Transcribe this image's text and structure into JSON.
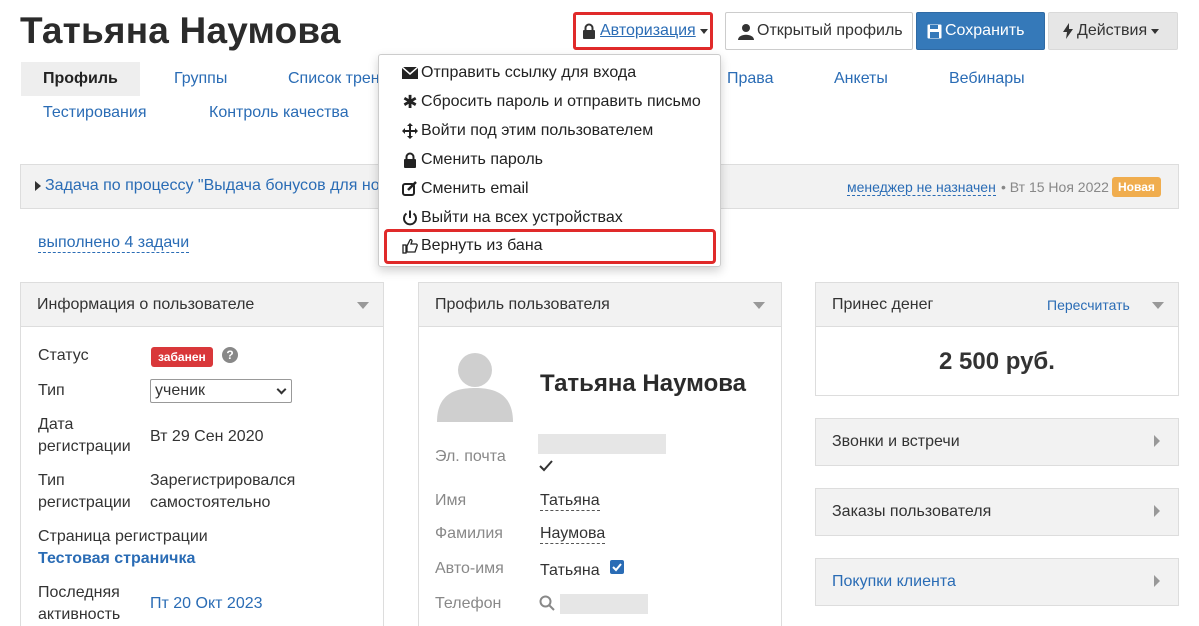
{
  "header": {
    "title": "Татьяна Наумова",
    "auth_label": "Авторизация",
    "open_profile_label": "Открытый профиль",
    "save_label": "Сохранить",
    "actions_label": "Действия"
  },
  "tabs": [
    {
      "label": "Профиль",
      "active": true
    },
    {
      "label": "Группы"
    },
    {
      "label": "Список трен"
    },
    {
      "label": "Права"
    },
    {
      "label": "Анкеты"
    },
    {
      "label": "Вебинары"
    },
    {
      "label": "Тестирования"
    },
    {
      "label": "Контроль качества"
    }
  ],
  "auth_menu": {
    "items": [
      {
        "label": "Отправить ссылку для входа",
        "icon": "envelope-icon"
      },
      {
        "label": "Сбросить пароль и отправить письмо",
        "icon": "asterisk-icon"
      },
      {
        "label": "Войти под этим пользователем",
        "icon": "move-icon"
      },
      {
        "label": "Сменить пароль",
        "icon": "lock-icon"
      },
      {
        "label": "Сменить email",
        "icon": "edit-icon"
      },
      {
        "label": "Выйти на всех устройствах",
        "icon": "power-icon"
      },
      {
        "label": "Вернуть из бана",
        "icon": "thumbs-up-icon"
      }
    ]
  },
  "task": {
    "text": "Задача по процессу \"Выдача бонусов для нов",
    "manager": "менеджер не назначен",
    "date": "• Вт 15 Ноя 2022",
    "badge": "Новая",
    "done_link": "выполнено 4 задачи"
  },
  "user_info": {
    "title": "Информация о пользователе",
    "status_label": "Статус",
    "status_value": "забанен",
    "type_label": "Тип",
    "type_value": "ученик",
    "reg_date_label_1": "Дата",
    "reg_date_label_2": "регистрации",
    "reg_date_value": "Вт 29 Сен 2020",
    "reg_type_label_1": "Тип",
    "reg_type_label_2": "регистрации",
    "reg_type_value_1": "Зарегистрировался",
    "reg_type_value_2": "самостоятельно",
    "reg_page_label": "Страница регистрации",
    "reg_page_value": "Тестовая страничка",
    "last_activity_label_1": "Последняя",
    "last_activity_label_2": "активность",
    "last_activity_value": "Пт 20 Окт 2023"
  },
  "profile": {
    "title": "Профиль пользователя",
    "name": "Татьяна Наумова",
    "email_label": "Эл. почта",
    "first_name_label": "Имя",
    "first_name_value": "Татьяна",
    "last_name_label": "Фамилия",
    "last_name_value": "Наумова",
    "auto_name_label": "Авто-имя",
    "auto_name_value": "Татьяна",
    "phone_label": "Телефон"
  },
  "money": {
    "title": "Принес денег",
    "recalc": "Пересчитать",
    "value": "2 500 руб."
  },
  "right_panels": {
    "calls": "Звонки и встречи",
    "orders": "Заказы пользователя",
    "purchases": "Покупки клиента"
  },
  "colors": {
    "link": "#2a6cb5",
    "primary_button": "#3579b9",
    "highlight": "#e02a2a",
    "banned_badge": "#d9383a",
    "new_badge": "#f0ad4e"
  }
}
